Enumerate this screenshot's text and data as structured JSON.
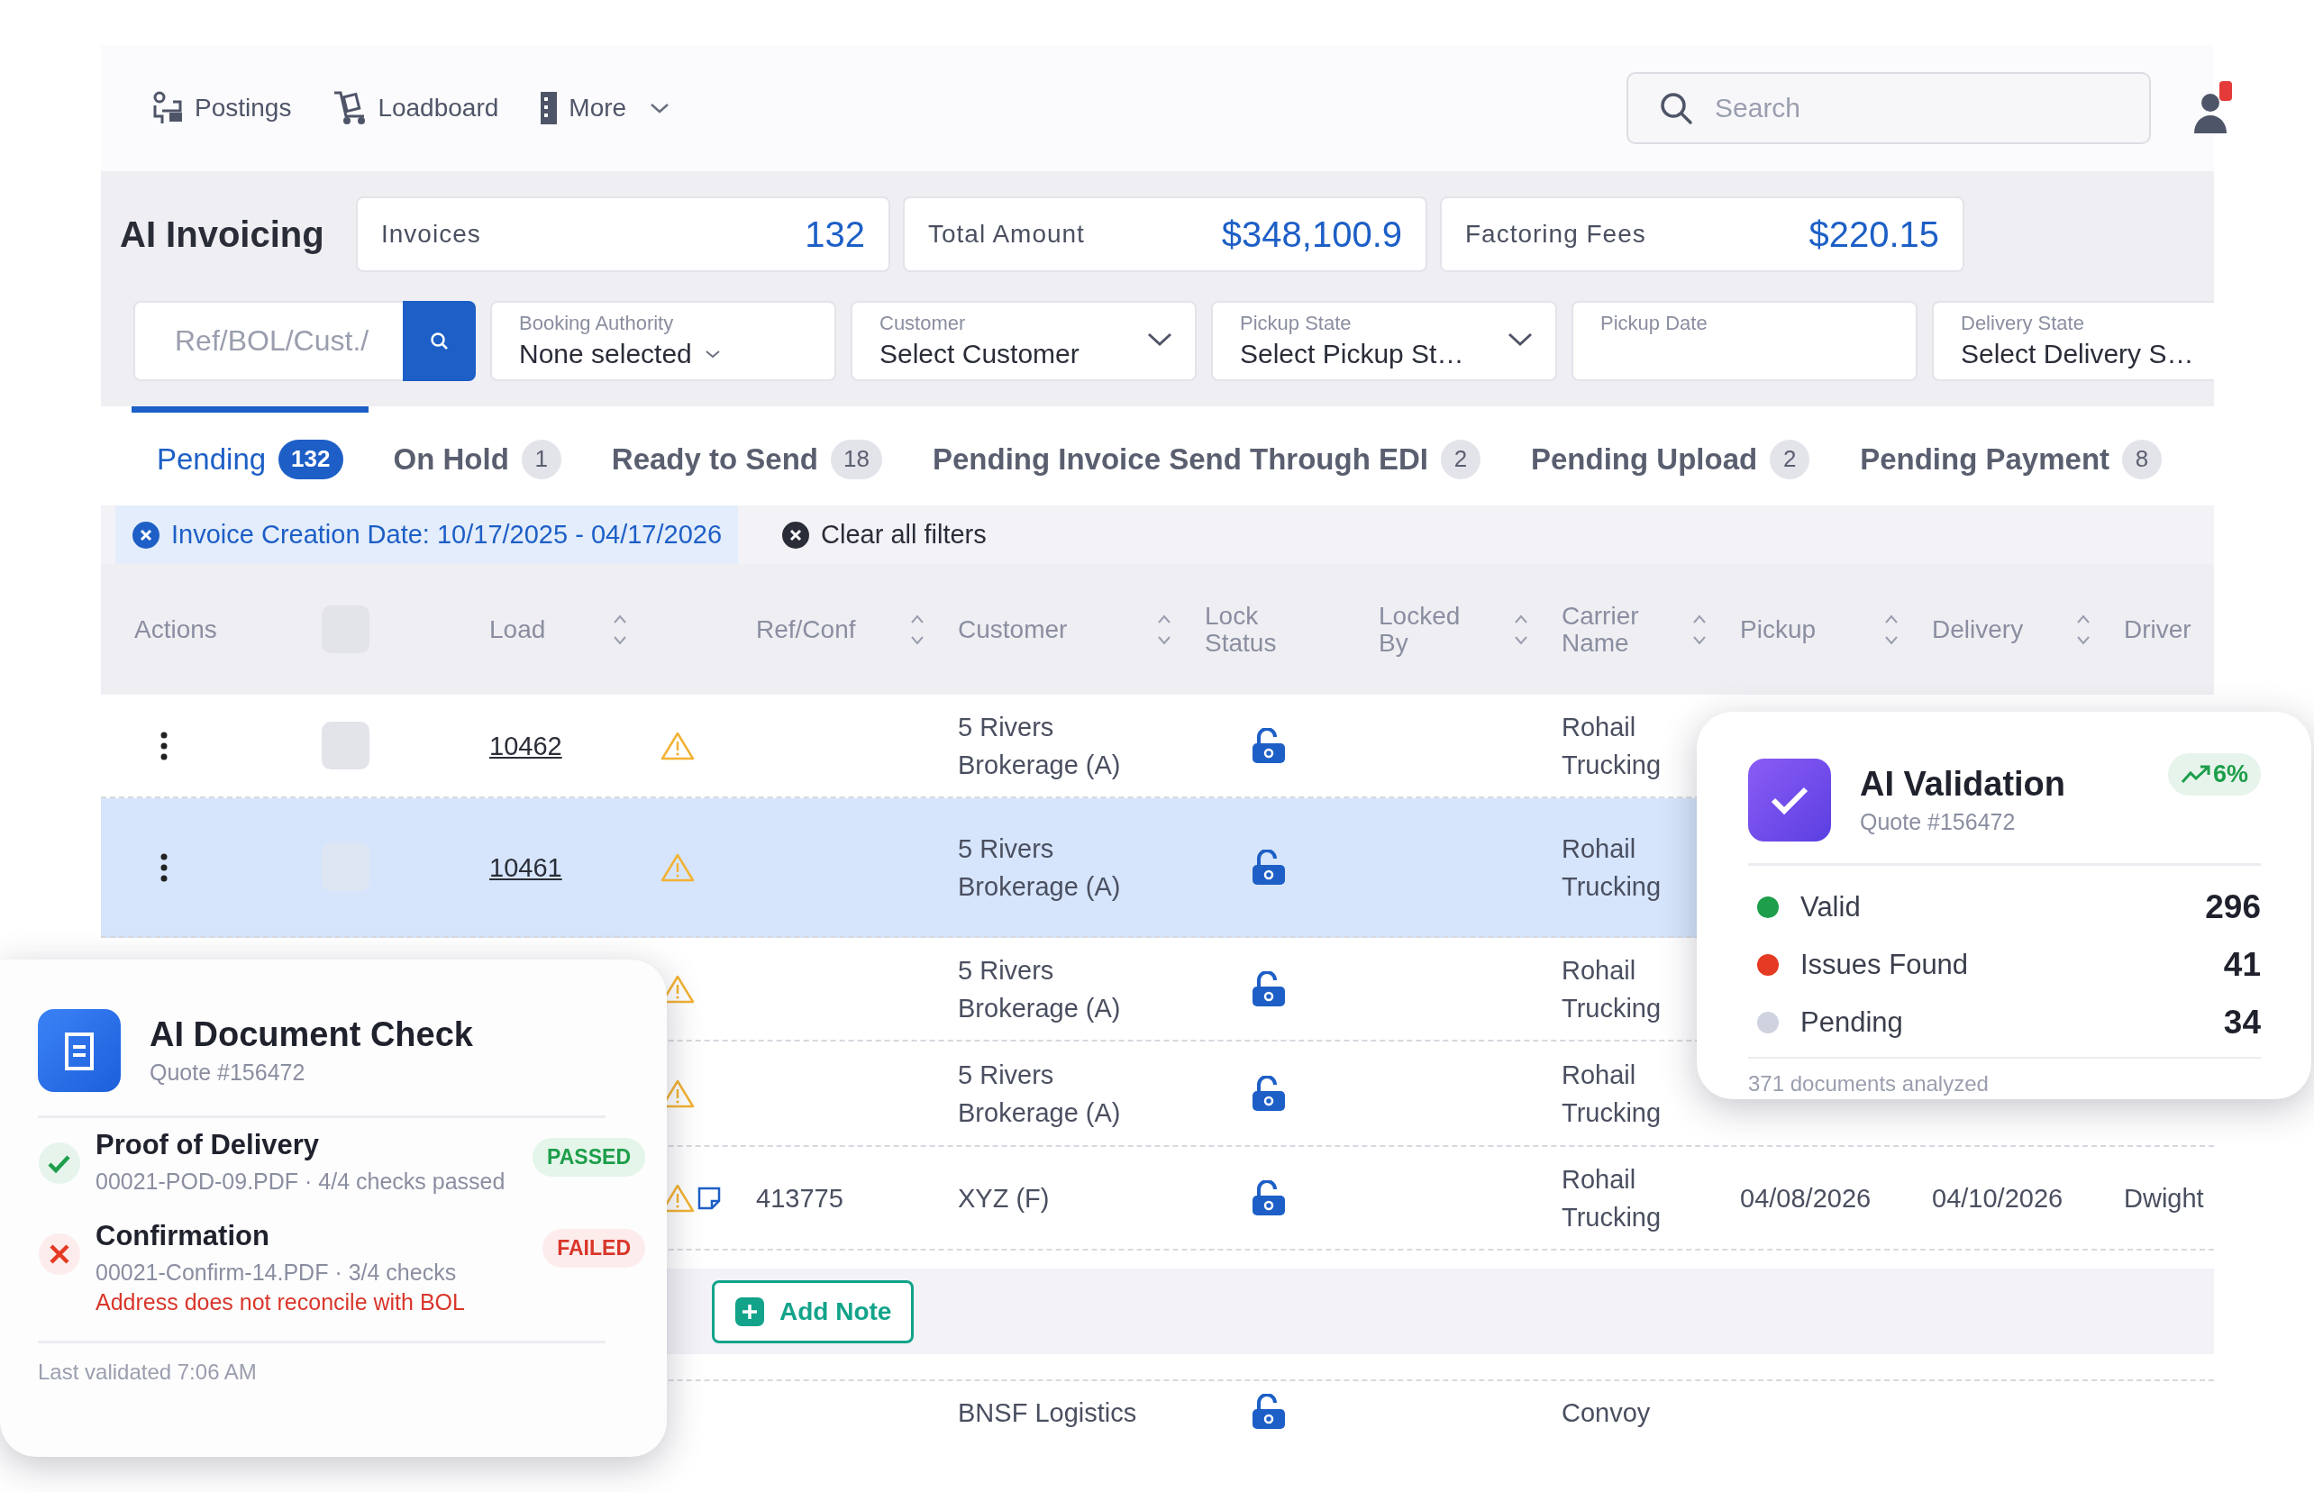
{
  "nav": {
    "items": [
      {
        "label": "Postings",
        "has_menu": false
      },
      {
        "label": "Loadboard",
        "has_menu": false
      },
      {
        "label": "More",
        "has_menu": true
      }
    ]
  },
  "search": {
    "placeholder": "Search"
  },
  "page_title": "AI Invoicing",
  "stats": [
    {
      "label": "Invoices",
      "value": "132"
    },
    {
      "label": "Total Amount",
      "value": "$348,100.9"
    },
    {
      "label": "Factoring Fees",
      "value": "$220.15"
    }
  ],
  "filters": {
    "search_placeholder": "Ref/BOL/Cust./",
    "fields": [
      {
        "label": "Booking Authority",
        "value": "None selected",
        "kind": "multiselect"
      },
      {
        "label": "Customer",
        "value": "Select Customer",
        "kind": "select"
      },
      {
        "label": "Pickup State",
        "value": "Select Pickup St…",
        "kind": "select"
      },
      {
        "label": "Pickup Date",
        "kind": "date"
      },
      {
        "label": "Delivery State",
        "value": "Select Delivery S…",
        "kind": "plain"
      }
    ]
  },
  "tabs": [
    {
      "label": "Pending",
      "count": "132",
      "selected": true
    },
    {
      "label": "On Hold",
      "count": "1",
      "selected": false
    },
    {
      "label": "Ready to Send",
      "count": "18",
      "selected": false
    },
    {
      "label": "Pending Invoice Send Through EDI",
      "count": "2",
      "selected": false
    },
    {
      "label": "Pending Upload",
      "count": "2",
      "selected": false
    },
    {
      "label": "Pending Payment",
      "count": "8",
      "selected": false
    }
  ],
  "active_filters": [
    {
      "label": "Invoice Creation Date: 10/17/2025 - 04/17/2026"
    }
  ],
  "clear_filters": "Clear all filters",
  "table": {
    "select_all": {
      "checked": false
    },
    "columns": [
      {
        "label": "Actions",
        "sortable": false
      },
      {
        "label": "Load",
        "sortable": true
      },
      {
        "label": "Ref/Conf",
        "sortable": true
      },
      {
        "label": "Customer",
        "sortable": true
      },
      {
        "label": "Lock Status",
        "sortable": false
      },
      {
        "label": "Locked By",
        "sortable": true
      },
      {
        "label": "Carrier Name",
        "sortable": true
      },
      {
        "label": "Pickup",
        "sortable": true
      },
      {
        "label": "Delivery",
        "sortable": true
      },
      {
        "label": "Driver",
        "sortable": false
      }
    ],
    "rows": [
      {
        "kind": "load",
        "selected": false,
        "actions": true,
        "checked": false,
        "load": "10462",
        "warning": true,
        "customer": "5 Rivers Brokerage (A)",
        "locked": false,
        "carrier": "Rohail Trucking"
      },
      {
        "kind": "load",
        "selected": true,
        "actions": true,
        "checked": false,
        "load": "10461",
        "warning": true,
        "customer": "5 Rivers Brokerage (A)",
        "locked": false,
        "carrier": "Rohail Trucking"
      },
      {
        "kind": "load",
        "selected": false,
        "warning": true,
        "customer": "5 Rivers Brokerage (A)",
        "locked": false,
        "carrier": "Rohail Trucking"
      },
      {
        "kind": "load",
        "selected": false,
        "warning": true,
        "customer": "5 Rivers Brokerage (A)",
        "locked": false,
        "carrier": "Rohail Trucking"
      },
      {
        "kind": "load",
        "selected": false,
        "warning": true,
        "note": true,
        "ref": "413775",
        "customer": "XYZ (F)",
        "locked": false,
        "carrier": "Rohail Trucking",
        "pickup": "04/08/2026",
        "delivery": "04/10/2026",
        "driver": "Dwight"
      },
      {
        "kind": "notes",
        "button": "Add Note"
      },
      {
        "kind": "load",
        "selected": false,
        "customer": "BNSF Logistics",
        "locked": false,
        "carrier": "Convoy"
      }
    ]
  },
  "doc_check": {
    "title": "AI Document Check",
    "subtitle": "Quote #156472",
    "items": [
      {
        "title": "Proof of Delivery",
        "detail": "00021-POD-09.PDF · 4/4 checks passed",
        "status": "PASSED",
        "passed": true
      },
      {
        "title": "Confirmation",
        "detail": "00021-Confirm-14.PDF · 3/4 checks",
        "error": "Address does not reconcile with BOL",
        "status": "FAILED",
        "passed": false
      }
    ],
    "footer": "Last validated 7:06 AM"
  },
  "validation": {
    "title": "AI Validation",
    "subtitle": "Quote #156472",
    "trend": "6%",
    "stats": [
      {
        "label": "Valid",
        "value": "296",
        "color": "#1e9e4a"
      },
      {
        "label": "Issues Found",
        "value": "41",
        "color": "#e53a23"
      },
      {
        "label": "Pending",
        "value": "34",
        "color": "#cfd3e0"
      }
    ],
    "footer": "371 documents analyzed"
  }
}
